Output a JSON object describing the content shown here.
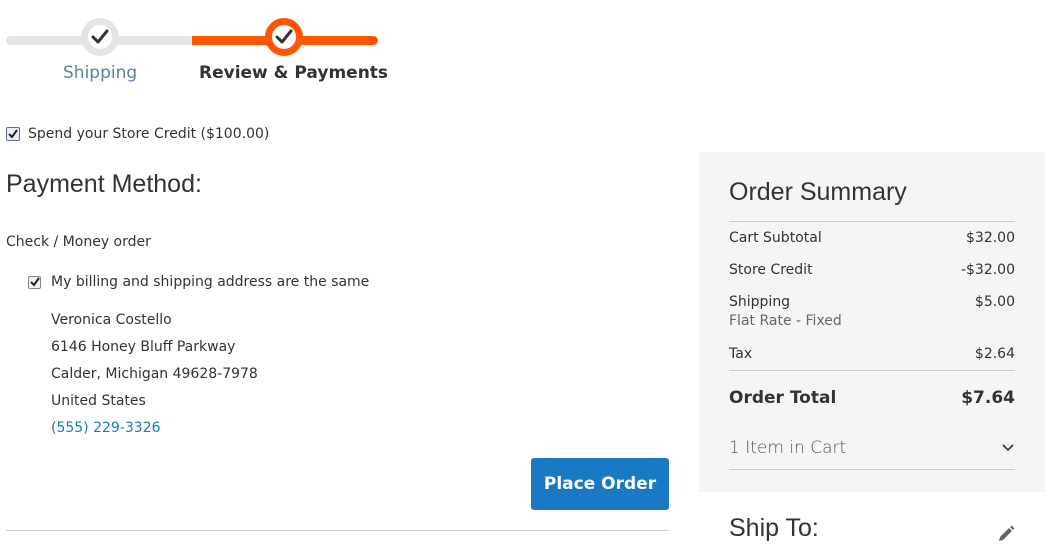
{
  "progress": {
    "steps": [
      {
        "label": "Shipping"
      },
      {
        "label": "Review & Payments"
      }
    ]
  },
  "store_credit": {
    "label": "Spend your Store Credit ($100.00)",
    "checked": true
  },
  "payment": {
    "title": "Payment Method:",
    "method": "Check / Money order",
    "same_address_label": "My billing and shipping address are the same",
    "address": {
      "name": "Veronica Costello",
      "street": "6146 Honey Bluff Parkway",
      "city": "Calder, Michigan 49628-7978",
      "country": "United States",
      "phone": "(555) 229-3326"
    },
    "place_order_label": "Place Order"
  },
  "summary": {
    "title": "Order Summary",
    "rows": [
      {
        "label": "Cart Subtotal",
        "value": "$32.00"
      },
      {
        "label": "Store Credit",
        "value": "-$32.00"
      },
      {
        "label": "Shipping",
        "sub": "Flat Rate - Fixed",
        "value": "$5.00"
      },
      {
        "label": "Tax",
        "value": "$2.64"
      }
    ],
    "total_label": "Order Total",
    "total_value": "$7.64",
    "items_in_cart": "1 Item in Cart"
  },
  "ship_to": {
    "title": "Ship To:"
  },
  "colors": {
    "accent": "#ff5501",
    "primary": "#1979c3",
    "link": "#5e7ea9"
  }
}
